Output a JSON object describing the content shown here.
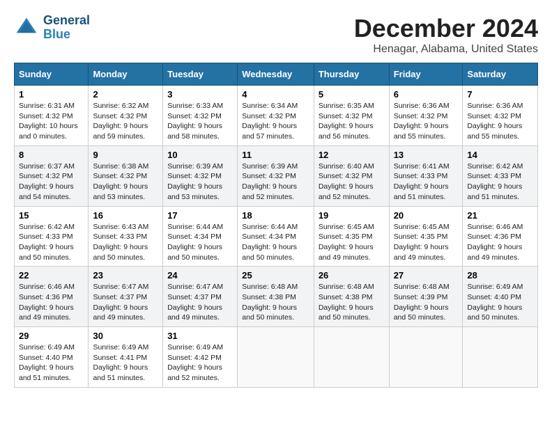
{
  "header": {
    "logo_line1": "General",
    "logo_line2": "Blue",
    "month": "December 2024",
    "location": "Henagar, Alabama, United States"
  },
  "days_of_week": [
    "Sunday",
    "Monday",
    "Tuesday",
    "Wednesday",
    "Thursday",
    "Friday",
    "Saturday"
  ],
  "weeks": [
    [
      {
        "day": "1",
        "sunrise": "6:31 AM",
        "sunset": "4:32 PM",
        "daylight": "10 hours and 0 minutes."
      },
      {
        "day": "2",
        "sunrise": "6:32 AM",
        "sunset": "4:32 PM",
        "daylight": "9 hours and 59 minutes."
      },
      {
        "day": "3",
        "sunrise": "6:33 AM",
        "sunset": "4:32 PM",
        "daylight": "9 hours and 58 minutes."
      },
      {
        "day": "4",
        "sunrise": "6:34 AM",
        "sunset": "4:32 PM",
        "daylight": "9 hours and 57 minutes."
      },
      {
        "day": "5",
        "sunrise": "6:35 AM",
        "sunset": "4:32 PM",
        "daylight": "9 hours and 56 minutes."
      },
      {
        "day": "6",
        "sunrise": "6:36 AM",
        "sunset": "4:32 PM",
        "daylight": "9 hours and 55 minutes."
      },
      {
        "day": "7",
        "sunrise": "6:36 AM",
        "sunset": "4:32 PM",
        "daylight": "9 hours and 55 minutes."
      }
    ],
    [
      {
        "day": "8",
        "sunrise": "6:37 AM",
        "sunset": "4:32 PM",
        "daylight": "9 hours and 54 minutes."
      },
      {
        "day": "9",
        "sunrise": "6:38 AM",
        "sunset": "4:32 PM",
        "daylight": "9 hours and 53 minutes."
      },
      {
        "day": "10",
        "sunrise": "6:39 AM",
        "sunset": "4:32 PM",
        "daylight": "9 hours and 53 minutes."
      },
      {
        "day": "11",
        "sunrise": "6:39 AM",
        "sunset": "4:32 PM",
        "daylight": "9 hours and 52 minutes."
      },
      {
        "day": "12",
        "sunrise": "6:40 AM",
        "sunset": "4:32 PM",
        "daylight": "9 hours and 52 minutes."
      },
      {
        "day": "13",
        "sunrise": "6:41 AM",
        "sunset": "4:33 PM",
        "daylight": "9 hours and 51 minutes."
      },
      {
        "day": "14",
        "sunrise": "6:42 AM",
        "sunset": "4:33 PM",
        "daylight": "9 hours and 51 minutes."
      }
    ],
    [
      {
        "day": "15",
        "sunrise": "6:42 AM",
        "sunset": "4:33 PM",
        "daylight": "9 hours and 50 minutes."
      },
      {
        "day": "16",
        "sunrise": "6:43 AM",
        "sunset": "4:33 PM",
        "daylight": "9 hours and 50 minutes."
      },
      {
        "day": "17",
        "sunrise": "6:44 AM",
        "sunset": "4:34 PM",
        "daylight": "9 hours and 50 minutes."
      },
      {
        "day": "18",
        "sunrise": "6:44 AM",
        "sunset": "4:34 PM",
        "daylight": "9 hours and 50 minutes."
      },
      {
        "day": "19",
        "sunrise": "6:45 AM",
        "sunset": "4:35 PM",
        "daylight": "9 hours and 49 minutes."
      },
      {
        "day": "20",
        "sunrise": "6:45 AM",
        "sunset": "4:35 PM",
        "daylight": "9 hours and 49 minutes."
      },
      {
        "day": "21",
        "sunrise": "6:46 AM",
        "sunset": "4:36 PM",
        "daylight": "9 hours and 49 minutes."
      }
    ],
    [
      {
        "day": "22",
        "sunrise": "6:46 AM",
        "sunset": "4:36 PM",
        "daylight": "9 hours and 49 minutes."
      },
      {
        "day": "23",
        "sunrise": "6:47 AM",
        "sunset": "4:37 PM",
        "daylight": "9 hours and 49 minutes."
      },
      {
        "day": "24",
        "sunrise": "6:47 AM",
        "sunset": "4:37 PM",
        "daylight": "9 hours and 49 minutes."
      },
      {
        "day": "25",
        "sunrise": "6:48 AM",
        "sunset": "4:38 PM",
        "daylight": "9 hours and 50 minutes."
      },
      {
        "day": "26",
        "sunrise": "6:48 AM",
        "sunset": "4:38 PM",
        "daylight": "9 hours and 50 minutes."
      },
      {
        "day": "27",
        "sunrise": "6:48 AM",
        "sunset": "4:39 PM",
        "daylight": "9 hours and 50 minutes."
      },
      {
        "day": "28",
        "sunrise": "6:49 AM",
        "sunset": "4:40 PM",
        "daylight": "9 hours and 50 minutes."
      }
    ],
    [
      {
        "day": "29",
        "sunrise": "6:49 AM",
        "sunset": "4:40 PM",
        "daylight": "9 hours and 51 minutes."
      },
      {
        "day": "30",
        "sunrise": "6:49 AM",
        "sunset": "4:41 PM",
        "daylight": "9 hours and 51 minutes."
      },
      {
        "day": "31",
        "sunrise": "6:49 AM",
        "sunset": "4:42 PM",
        "daylight": "9 hours and 52 minutes."
      },
      null,
      null,
      null,
      null
    ]
  ]
}
